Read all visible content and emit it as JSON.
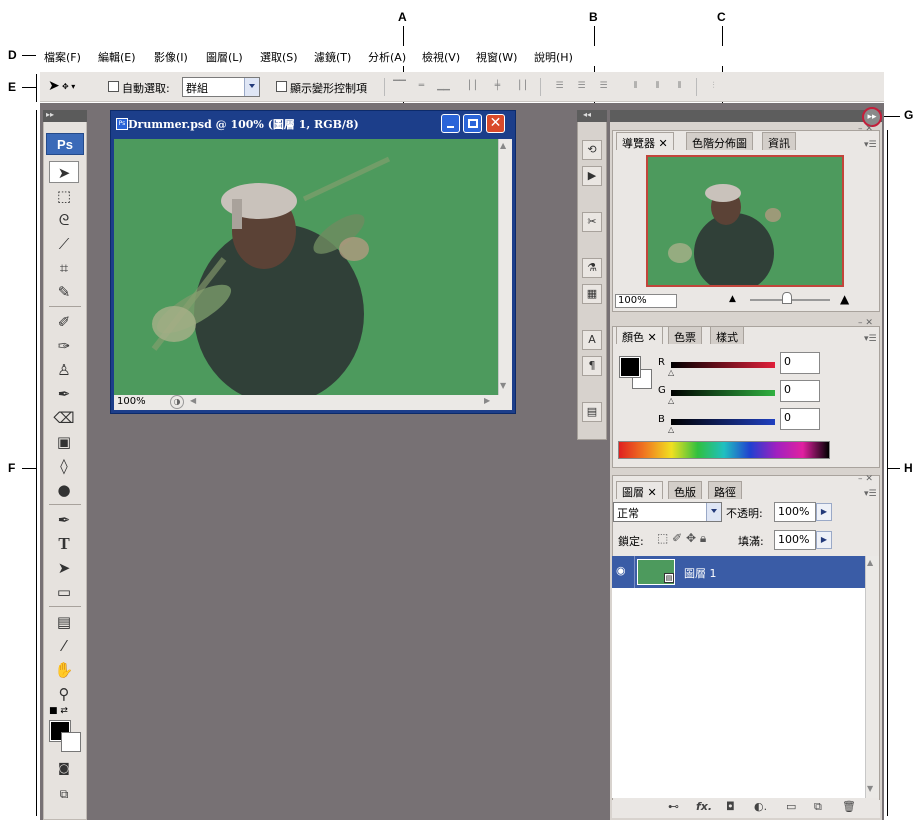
{
  "callouts": [
    "A",
    "B",
    "C",
    "D",
    "E",
    "F",
    "G",
    "H"
  ],
  "menubar": {
    "items": [
      "檔案(F)",
      "編輯(E)",
      "影像(I)",
      "圖層(L)",
      "選取(S)",
      "濾鏡(T)",
      "分析(A)",
      "檢視(V)",
      "視窗(W)",
      "說明(H)"
    ]
  },
  "options_bar": {
    "auto_select_label": "自動選取:",
    "auto_select_value": "群組",
    "show_transform_label": "顯示變形控制項"
  },
  "toolbox": {
    "logo": "Ps",
    "tools": [
      "move-tool",
      "marquee-tool",
      "lasso-tool",
      "magic-wand-tool",
      "crop-tool",
      "slice-tool",
      "healing-brush-tool",
      "brush-tool",
      "clone-stamp-tool",
      "history-brush-tool",
      "eraser-tool",
      "gradient-tool",
      "blur-tool",
      "dodge-tool",
      "pen-tool",
      "type-tool",
      "path-selection-tool",
      "shape-tool",
      "notes-tool",
      "eyedropper-tool",
      "hand-tool",
      "zoom-tool"
    ],
    "type_tool_glyph": "T"
  },
  "document": {
    "title": "Drummer.psd @ 100% (圖層 1, RGB/8)",
    "zoom": "100%"
  },
  "navigator_panel": {
    "tabs": [
      "導覽器",
      "色階分佈圖",
      "資訊"
    ],
    "zoom": "100%"
  },
  "color_panel": {
    "tabs": [
      "顏色",
      "色票",
      "樣式"
    ],
    "r_label": "R",
    "g_label": "G",
    "b_label": "B",
    "r_value": "0",
    "g_value": "0",
    "b_value": "0"
  },
  "layers_panel": {
    "tabs": [
      "圖層",
      "色版",
      "路徑"
    ],
    "blend_mode": "正常",
    "opacity_label": "不透明:",
    "opacity_value": "100%",
    "lock_label": "鎖定:",
    "fill_label": "填滿:",
    "fill_value": "100%",
    "layer_name": "圖層 1"
  },
  "colors": {
    "workspace": "#777174",
    "canvas_green": "#4d9a5d",
    "titlebar": "#1c3e8a",
    "selected_layer": "#3a5ca6",
    "collapse_ring": "#c41f3b"
  }
}
